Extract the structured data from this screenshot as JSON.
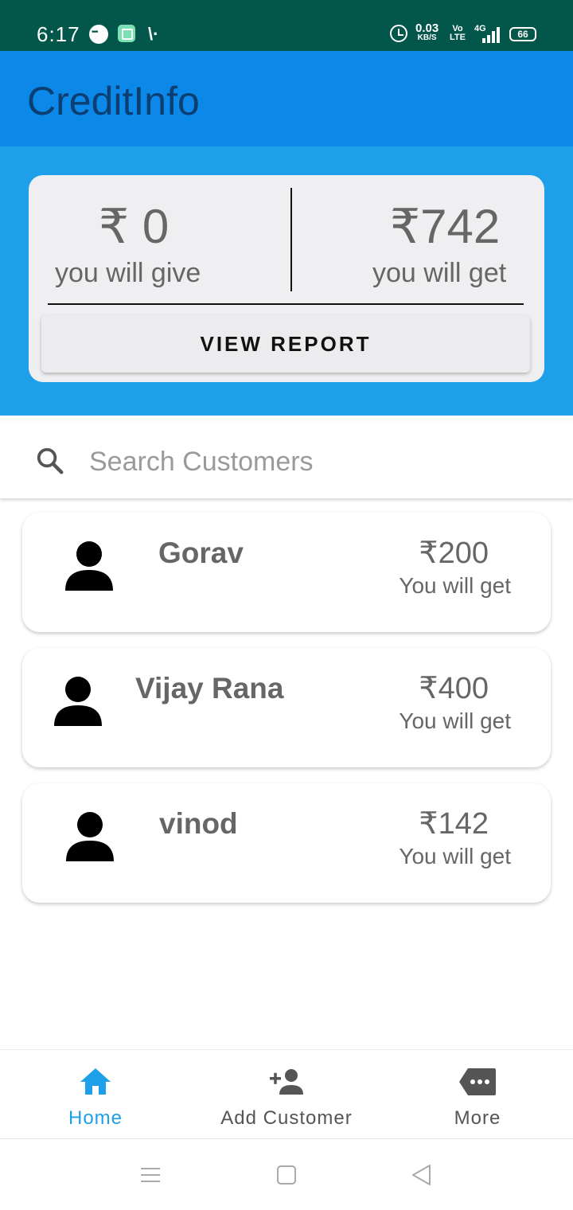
{
  "status_bar": {
    "time": "6:17",
    "net_speed": "0.03",
    "net_speed_unit": "KB/S",
    "volte_top": "Vo",
    "volte_bottom": "LTE",
    "network": "4G",
    "battery": "66",
    "icons": [
      "chat-bubble-icon",
      "app-notification-icon",
      "signal-mark-icon",
      "alarm-icon",
      "signal-bars-icon",
      "battery-icon"
    ]
  },
  "app_bar": {
    "title": "CreditInfo"
  },
  "summary": {
    "give_amount": "₹ 0",
    "give_label": "you will give",
    "get_amount": "₹742",
    "get_label": "you will get",
    "report_button": "VIEW REPORT"
  },
  "search": {
    "placeholder": "Search Customers",
    "value": ""
  },
  "customers": [
    {
      "name": "Gorav",
      "amount": "₹200",
      "status": "You will get"
    },
    {
      "name": "Vijay Rana",
      "amount": "₹400",
      "status": "You will get"
    },
    {
      "name": "vinod",
      "amount": "₹142",
      "status": "You will get"
    }
  ],
  "bottom_nav": {
    "items": [
      {
        "label": "Home",
        "icon": "home-icon",
        "active": true
      },
      {
        "label": "Add Customer",
        "icon": "add-person-icon",
        "active": false
      },
      {
        "label": "More",
        "icon": "more-tag-icon",
        "active": false
      }
    ]
  },
  "colors": {
    "status_bar": "#02574a",
    "app_bar": "#0b88e8",
    "summary_bg": "#1e9fe9",
    "title_text": "#0b3f72",
    "active_nav": "#1e9fe9"
  }
}
